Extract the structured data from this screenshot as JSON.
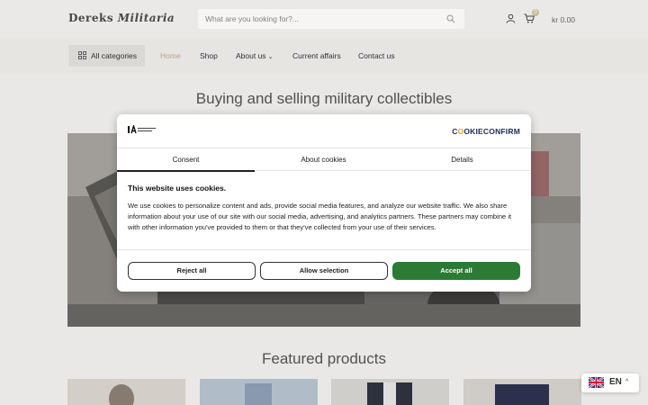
{
  "header": {
    "logo_word1": "Dereks",
    "logo_word2": "Militaria",
    "search_placeholder": "What are you looking for?...",
    "cart_count": "0",
    "cart_total": "kr  0.00"
  },
  "nav": {
    "all_categories": "All categories",
    "links": [
      {
        "label": "Home",
        "active": true
      },
      {
        "label": "Shop"
      },
      {
        "label": "About us",
        "has_dropdown": true
      },
      {
        "label": "Current affairs"
      },
      {
        "label": "Contact us"
      }
    ]
  },
  "main": {
    "hero_title": "Buying and selling military collectibles",
    "featured_title": "Featured products"
  },
  "cookie": {
    "brand_prefix": "C",
    "brand_o": "O",
    "brand_suffix": "OKIECONFIRM",
    "tabs": [
      "Consent",
      "About cookies",
      "Details"
    ],
    "heading": "This website uses cookies.",
    "body": "We use cookies to personalize content and ads, provide social media features, and analyze our website traffic. We also share information about your use of our site with our social media, advertising, and analytics partners. These partners may combine it with other information you've provided to them or that they've collected from your use of their services.",
    "reject": "Reject all",
    "allow": "Allow selection",
    "accept": "Accept all"
  },
  "language": {
    "code": "EN"
  },
  "colors": {
    "accept_green": "#2b7b35",
    "active_nav": "#bfa990",
    "cookieconfirm_navy": "#1a2a5a"
  }
}
